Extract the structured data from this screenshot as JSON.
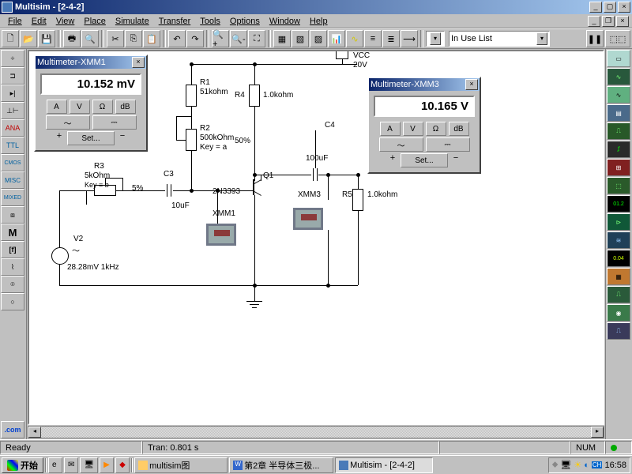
{
  "window": {
    "title": "Multisim - [2-4-2]"
  },
  "menus": [
    "File",
    "Edit",
    "View",
    "Place",
    "Simulate",
    "Transfer",
    "Tools",
    "Options",
    "Window",
    "Help"
  ],
  "combo_in_use": "In Use List",
  "left_palette": [
    "÷",
    "⊐",
    "▸|",
    "⊥⊢",
    "ANA",
    "TTL",
    "CMOS",
    "MISC",
    "MIXED",
    "⧈",
    "M",
    "[f]",
    "⌇",
    "⌾",
    "○",
    ".com"
  ],
  "right_palette_colors": [
    "#b0d8d0",
    "#28583c",
    "#60b080",
    "#4a6a8a",
    "#285828",
    "#2a2a2a",
    "#802020",
    "#2a5a2a",
    "#008030",
    "#105838",
    "#204058",
    "#b0a040",
    "#c07830",
    "#2a5a3a",
    "#3a7a4a",
    "#3a3a5a"
  ],
  "status": {
    "ready": "Ready",
    "tran": "Tran: 0.801 s",
    "num": "NUM"
  },
  "multimeter1": {
    "title": "Multimeter-XMM1",
    "value": "10.152 mV",
    "btns": [
      "A",
      "V",
      "Ω",
      "dB"
    ],
    "set": "Set..."
  },
  "multimeter3": {
    "title": "Multimeter-XMM3",
    "value": "10.165   V",
    "btns": [
      "A",
      "V",
      "Ω",
      "dB"
    ],
    "set": "Set..."
  },
  "circuit": {
    "vcc": {
      "label": "VCC",
      "val": "20V"
    },
    "r1": {
      "name": "R1",
      "val": "51kohm"
    },
    "r2": {
      "name": "R2",
      "val": "500kOhm",
      "key": "Key = a",
      "pct": "50%"
    },
    "r3": {
      "name": "R3",
      "val": "5kOhm",
      "key": "Key = b",
      "pct": "5%"
    },
    "r4": {
      "name": "R4",
      "val": "1.0kohm"
    },
    "r5": {
      "name": "R5",
      "val": "1.0kohm"
    },
    "c3": {
      "name": "C3",
      "val": "10uF"
    },
    "c4": {
      "name": "C4",
      "val": "100uF"
    },
    "q1": {
      "name": "Q1",
      "type": "2N3393"
    },
    "v2": {
      "name": "V2",
      "val": "28.28mV 1kHz"
    },
    "xmm1": "XMM1",
    "xmm3": "XMM3"
  },
  "taskbar": {
    "start": "开始",
    "items": [
      {
        "label": "multisim图",
        "active": false
      },
      {
        "label": "第2章 半导体三极...",
        "active": false
      },
      {
        "label": "Multisim - [2-4-2]",
        "active": true
      }
    ],
    "clock": "16:58"
  }
}
